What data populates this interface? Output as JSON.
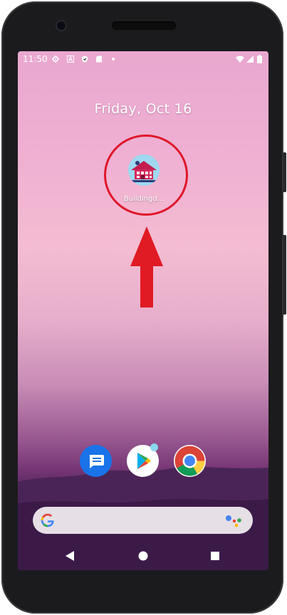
{
  "status_bar": {
    "time": "11:50",
    "left_icons": [
      "settings-icon",
      "a-icon",
      "shield-icon",
      "sd-card-icon",
      "dot-icon"
    ],
    "right_icons": [
      "wifi-icon",
      "signal-icon",
      "battery-icon"
    ]
  },
  "home": {
    "date": "Friday, Oct 16",
    "app": {
      "label": "Buildingd..."
    }
  },
  "annotation": {
    "highlight_color": "#e0172a",
    "arrow_color": "#e01b24"
  },
  "dock": {
    "apps": [
      "messages-icon",
      "play-store-icon",
      "chrome-icon"
    ]
  },
  "search": {
    "google_icon": "google-g-icon",
    "assistant_icon": "google-assistant-icon"
  },
  "navigation": {
    "buttons": [
      "back-icon",
      "home-icon",
      "recents-icon"
    ]
  }
}
